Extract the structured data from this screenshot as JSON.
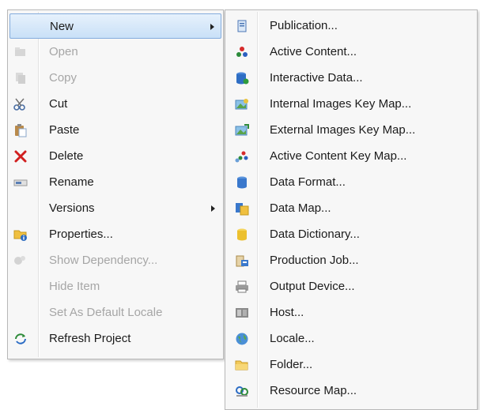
{
  "context_menu": {
    "items": [
      {
        "label": "New",
        "icon": "new-icon",
        "disabled": false,
        "submenu": true,
        "highlighted": true
      },
      {
        "label": "Open",
        "icon": "open-icon",
        "disabled": true
      },
      {
        "label": "Copy",
        "icon": "copy-icon",
        "disabled": true
      },
      {
        "label": "Cut",
        "icon": "scissors-icon",
        "disabled": false
      },
      {
        "label": "Paste",
        "icon": "paste-icon",
        "disabled": false
      },
      {
        "label": "Delete",
        "icon": "delete-x-icon",
        "disabled": false
      },
      {
        "label": "Rename",
        "icon": "rename-icon",
        "disabled": false
      },
      {
        "label": "Versions",
        "icon": "",
        "disabled": false,
        "submenu": true
      },
      {
        "label": "Properties...",
        "icon": "properties-icon",
        "disabled": false
      },
      {
        "label": "Show Dependency...",
        "icon": "dependency-icon",
        "disabled": true
      },
      {
        "label": "Hide Item",
        "icon": "",
        "disabled": true
      },
      {
        "label": "Set As Default Locale",
        "icon": "",
        "disabled": true
      },
      {
        "label": "Refresh Project",
        "icon": "refresh-icon",
        "disabled": false
      }
    ]
  },
  "submenu": {
    "items": [
      {
        "label": "Publication...",
        "icon": "publication-icon"
      },
      {
        "label": "Active Content...",
        "icon": "active-content-icon"
      },
      {
        "label": "Interactive Data...",
        "icon": "interactive-data-icon"
      },
      {
        "label": "Internal Images Key Map...",
        "icon": "internal-images-keymap-icon"
      },
      {
        "label": "External Images Key Map...",
        "icon": "external-images-keymap-icon"
      },
      {
        "label": "Active Content Key Map...",
        "icon": "active-content-keymap-icon"
      },
      {
        "label": "Data Format...",
        "icon": "data-format-icon"
      },
      {
        "label": "Data Map...",
        "icon": "data-map-icon"
      },
      {
        "label": "Data Dictionary...",
        "icon": "data-dictionary-icon"
      },
      {
        "label": "Production Job...",
        "icon": "production-job-icon"
      },
      {
        "label": "Output Device...",
        "icon": "output-device-icon"
      },
      {
        "label": "Host...",
        "icon": "host-icon"
      },
      {
        "label": "Locale...",
        "icon": "locale-icon"
      },
      {
        "label": "Folder...",
        "icon": "folder-icon"
      },
      {
        "label": "Resource Map...",
        "icon": "resource-map-icon"
      }
    ]
  },
  "colors": {
    "highlight_border": "#84acdd",
    "disabled_text": "#a6a6a6",
    "menu_bg": "#f7f7f7"
  }
}
